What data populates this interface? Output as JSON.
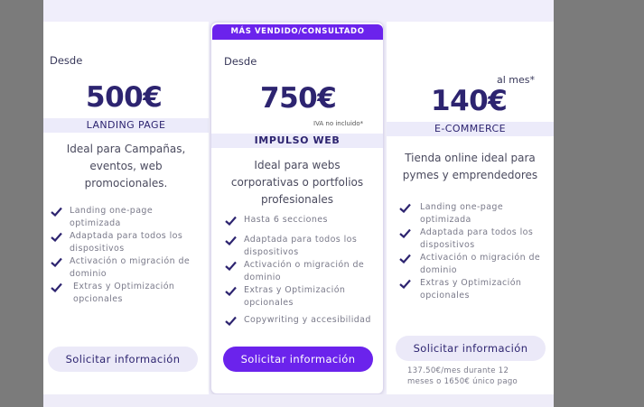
{
  "colors": {
    "accent": "#6b23ec",
    "navy": "#2d2470",
    "band": "#ecebfa"
  },
  "icons": {
    "check": "check-icon"
  },
  "plans": [
    {
      "desde": "Desde",
      "price": "500€",
      "name": "LANDING PAGE",
      "description": [
        "Ideal para Campañas,",
        "eventos, web",
        "promocionales."
      ],
      "features": [
        [
          "Landing one-page",
          "optimizada"
        ],
        [
          "Adaptada para todos los",
          "dispositivos"
        ],
        [
          "Activación o migración de",
          "dominio"
        ],
        [
          "Extras y Optimización",
          "opcionales"
        ]
      ],
      "button": "Solicitar información"
    },
    {
      "badge": "MÁS VENDIDO/CONSULTADO",
      "desde": "Desde",
      "price": "750€",
      "iva_note": "IVA no incluido*",
      "name": "IMPULSO WEB",
      "description": [
        "Ideal para webs",
        "corporativas o portfolios",
        "profesionales"
      ],
      "features": [
        [
          "Hasta 6 secciones"
        ],
        [
          "Adaptada para todos los",
          "dispositivos"
        ],
        [
          "Activación o migración de",
          "dominio"
        ],
        [
          "Extras y Optimización",
          "opcionales"
        ],
        [
          "Copywriting y accesibilidad"
        ]
      ],
      "button": "Solicitar información"
    },
    {
      "per_month": "al mes*",
      "price": "140€",
      "name": "E-COMMERCE",
      "description": [
        "Tienda online ideal para",
        "pymes y emprendedores"
      ],
      "features": [
        [
          "Landing one-page",
          "optimizada"
        ],
        [
          "Adaptada para todos los",
          "dispositivos"
        ],
        [
          "Activación o migración de",
          "dominio"
        ],
        [
          "Extras y Optimización",
          "opcionales"
        ]
      ],
      "button": "Solicitar información",
      "footnote": [
        "137.50€/mes durante 12",
        "meses o  1650€ único pago"
      ]
    }
  ]
}
